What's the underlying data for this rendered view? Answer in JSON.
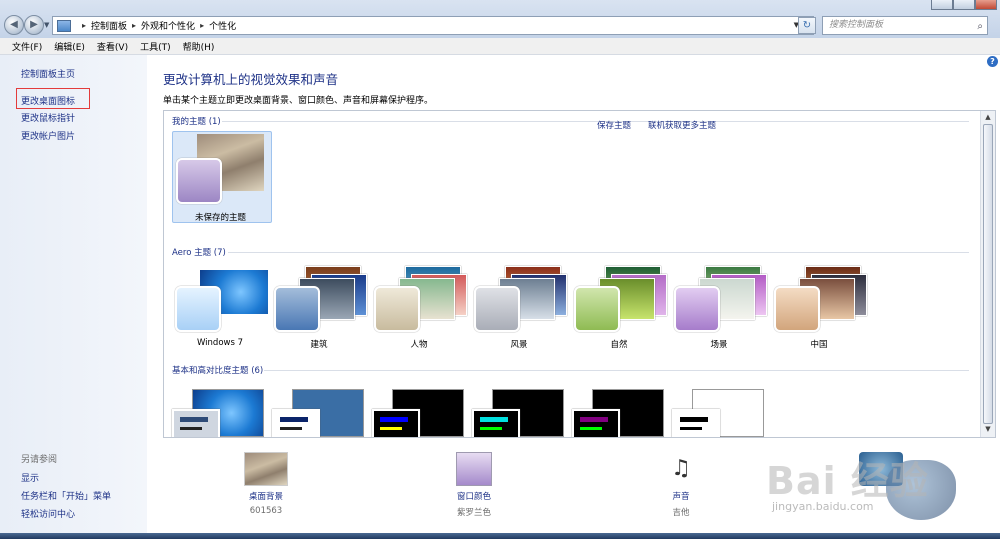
{
  "window": {
    "breadcrumbs": [
      "控制面板",
      "外观和个性化",
      "个性化"
    ],
    "search_placeholder": "搜索控制面板"
  },
  "menu": [
    "文件(F)",
    "编辑(E)",
    "查看(V)",
    "工具(T)",
    "帮助(H)"
  ],
  "left_pane": {
    "home": "控制面板主页",
    "links": [
      "更改桌面图标",
      "更改鼠标指针",
      "更改帐户图片"
    ],
    "see_also_title": "另请参阅",
    "see_also": [
      "显示",
      "任务栏和「开始」菜单",
      "轻松访问中心"
    ]
  },
  "main": {
    "title": "更改计算机上的视觉效果和声音",
    "subtitle": "单击某个主题立即更改桌面背景、窗口颜色、声音和屏幕保护程序。"
  },
  "themes": {
    "my_themes_title": "我的主题 (1)",
    "unsaved_label": "未保存的主题",
    "save_theme": "保存主题",
    "more_themes": "联机获取更多主题",
    "aero_title": "Aero 主题 (7)",
    "aero": [
      "Windows 7",
      "建筑",
      "人物",
      "风景",
      "自然",
      "场景",
      "中国"
    ],
    "basic_title": "基本和高对比度主题 (6)"
  },
  "bottom": {
    "desktop_bg": {
      "label": "桌面背景",
      "value": "601563"
    },
    "window_color": {
      "label": "窗口颜色",
      "value": "紫罗兰色"
    },
    "sound": {
      "label": "声音",
      "value": "吉他"
    }
  },
  "watermark": {
    "text": "Bai 经验",
    "sub": "jingyan.baidu.com"
  },
  "colors": {
    "link": "#1e3287",
    "left_pane_bg": "#e8eef7",
    "highlight_box": "#e33b3b",
    "selected_tile": "#dbe8f8"
  }
}
